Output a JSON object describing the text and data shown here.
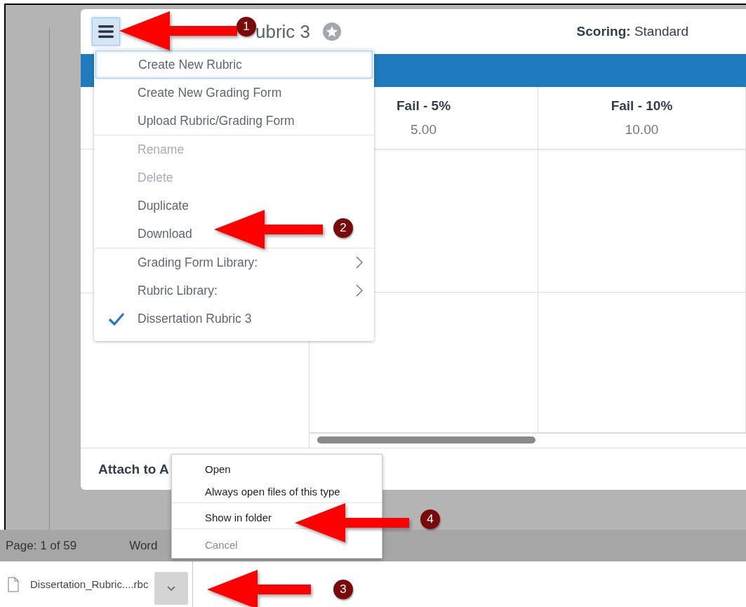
{
  "dialog": {
    "title": "ubric 3",
    "scoring_label": "Scoring:",
    "scoring_value": "Standard",
    "levels": [
      {
        "name": "Fail - 5%",
        "points": "5.00"
      },
      {
        "name": "Fail - 10%",
        "points": "10.00"
      }
    ],
    "footer": "Attach to A"
  },
  "rubric_menu": {
    "groups": [
      [
        {
          "label": "Create New Rubric",
          "selected": true,
          "disabled": false,
          "checked": false,
          "submenu": false
        },
        {
          "label": "Create New Grading Form",
          "selected": false,
          "disabled": false,
          "checked": false,
          "submenu": false
        },
        {
          "label": "Upload Rubric/Grading Form",
          "selected": false,
          "disabled": false,
          "checked": false,
          "submenu": false
        }
      ],
      [
        {
          "label": "Rename",
          "selected": false,
          "disabled": true,
          "checked": false,
          "submenu": false
        },
        {
          "label": "Delete",
          "selected": false,
          "disabled": true,
          "checked": false,
          "submenu": false
        },
        {
          "label": "Duplicate",
          "selected": false,
          "disabled": false,
          "checked": false,
          "submenu": false
        },
        {
          "label": "Download",
          "selected": false,
          "disabled": false,
          "checked": false,
          "submenu": false
        }
      ],
      [
        {
          "label": "Grading Form Library:",
          "selected": false,
          "disabled": false,
          "checked": false,
          "submenu": true
        },
        {
          "label": "Rubric Library:",
          "selected": false,
          "disabled": false,
          "checked": false,
          "submenu": true
        },
        {
          "label": "Dissertation Rubric 3",
          "selected": false,
          "disabled": false,
          "checked": true,
          "submenu": false
        }
      ]
    ]
  },
  "status_bar": {
    "page": "Page: 1 of 59",
    "words": "Word"
  },
  "download": {
    "file_name": "Dissertation_Rubric....rbc"
  },
  "download_menu": {
    "groups": [
      [
        {
          "label": "Open",
          "disabled": false
        },
        {
          "label": "Always open files of this type",
          "disabled": false
        }
      ],
      [
        {
          "label": "Show in folder",
          "disabled": false
        }
      ],
      [
        {
          "label": "Cancel",
          "disabled": true
        }
      ]
    ]
  },
  "callouts": [
    "1",
    "2",
    "3",
    "4"
  ]
}
